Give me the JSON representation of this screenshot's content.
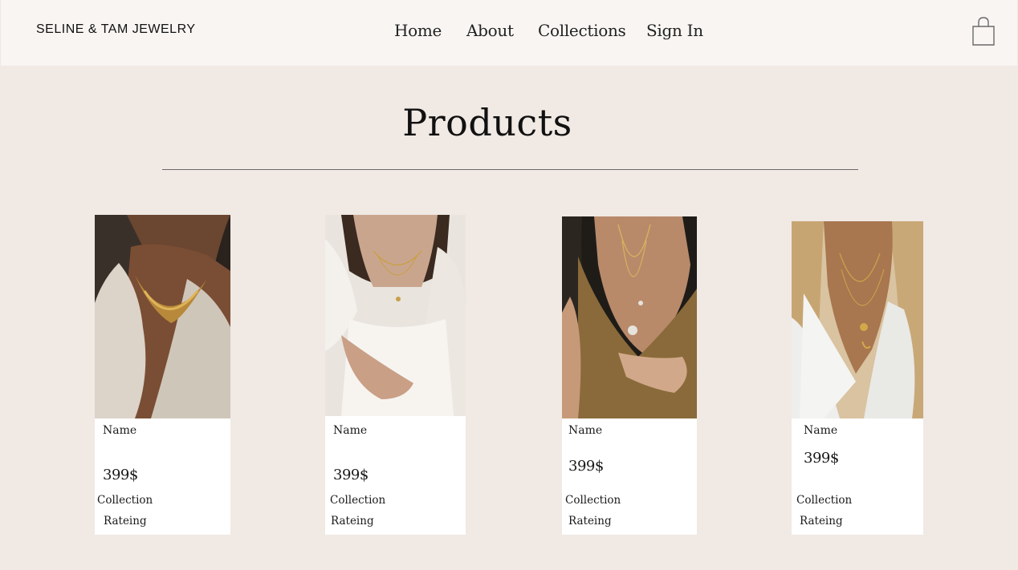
{
  "header": {
    "brand": "SELINE & TAM JEWELRY",
    "nav": [
      "Home",
      "About",
      "Collections",
      "Sign In"
    ],
    "cart_icon": "shopping-bag-icon"
  },
  "page": {
    "title": "Products"
  },
  "products": [
    {
      "name": "Name",
      "price": "399$",
      "collection": "Collection",
      "rating": "Rateing",
      "image": "woman-gold-bib-necklace-photo"
    },
    {
      "name": "Name",
      "price": "399$",
      "collection": "Collection",
      "rating": "Rateing",
      "image": "woman-layered-gold-necklaces-white-blouse-photo"
    },
    {
      "name": "Name",
      "price": "399$",
      "collection": "Collection",
      "rating": "Rateing",
      "image": "woman-pendant-necklace-gold-dress-photo"
    },
    {
      "name": "Name",
      "price": "399$",
      "collection": "Collection",
      "rating": "Rateing",
      "image": "woman-layered-coin-necklaces-white-shirt-photo"
    }
  ],
  "colors": {
    "page_background": "#f0e9e4",
    "header_background": "#f8f5f2",
    "card_background": "#ffffff",
    "divider": "#6d6a68"
  }
}
